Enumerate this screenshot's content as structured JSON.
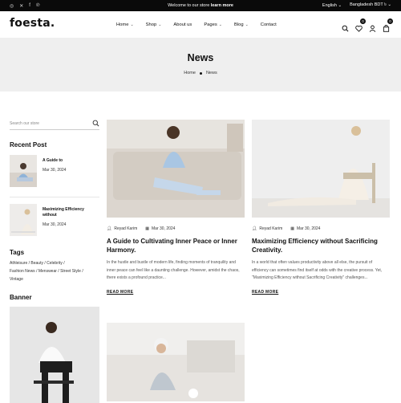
{
  "topbar": {
    "announce_text": "Welcome to our store",
    "announce_link": "learn more",
    "language": "English",
    "currency": "Bangladesh BDT ৳"
  },
  "header": {
    "logo": "foesta.",
    "nav": [
      {
        "label": "Home",
        "has_dropdown": true
      },
      {
        "label": "Shop",
        "has_dropdown": true
      },
      {
        "label": "About us",
        "has_dropdown": false
      },
      {
        "label": "Pages",
        "has_dropdown": true
      },
      {
        "label": "Blog",
        "has_dropdown": true
      },
      {
        "label": "Contact",
        "has_dropdown": false
      }
    ],
    "wishlist_count": "0",
    "cart_count": "0"
  },
  "hero": {
    "title": "News",
    "crumb_home": "Home",
    "crumb_current": "News"
  },
  "sidebar": {
    "search_placeholder": "Search our store",
    "recent_title": "Recent Post",
    "recent_posts": [
      {
        "title": "A Guide to",
        "date": "Mar 30, 2024"
      },
      {
        "title": "Maximizing Efficiency without",
        "date": "Mar 30, 2024"
      }
    ],
    "tags_title": "Tags",
    "tags_line1": "Athleisure /  Beauty /  Celebrity /",
    "tags_line2": "Fashion News /  Menswear /  Street Style /",
    "tags_line3": "Vintage",
    "banner_title": "Banner"
  },
  "posts": [
    {
      "author": "Reyad Karim",
      "date": "Mar 30, 2024",
      "title": "A Guide to Cultivating Inner Peace or Inner Harmony.",
      "excerpt": "In the hustle and bustle of modern life, finding moments of tranquility and inner peace can feel like a daunting challenge. However, amidst the chaos, there exists a profound practice...",
      "read_more": "READ MORE"
    },
    {
      "author": "Reyad Karim",
      "date": "Mar 30, 2024",
      "title": "Maximizing Efficiency without Sacrificing Creativity.",
      "excerpt": "In a world that often values productivity above all else, the pursuit of efficiency can sometimes find itself at odds with the creative process. Yet, \"Maximizing Efficiency without Sacrificing Creativity\" challenges...",
      "read_more": "READ MORE"
    }
  ],
  "icons": [
    "instagram-icon",
    "twitter-icon",
    "facebook-icon",
    "pinterest-icon",
    "search-icon",
    "wishlist-icon",
    "account-icon",
    "cart-icon",
    "user-icon",
    "calendar-icon"
  ]
}
